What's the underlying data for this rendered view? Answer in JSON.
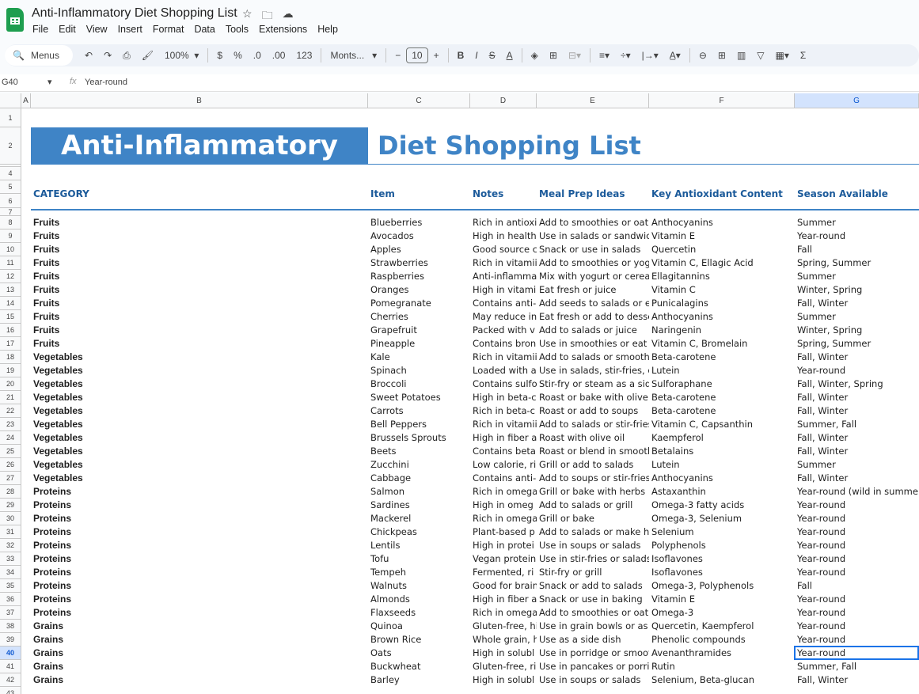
{
  "app": {
    "title": "Anti-Inflammatory Diet Shopping List",
    "menu": [
      "File",
      "Edit",
      "View",
      "Insert",
      "Format",
      "Data",
      "Tools",
      "Extensions",
      "Help"
    ]
  },
  "toolbar": {
    "search": "Menus",
    "zoom": "100%",
    "currency": "$",
    "percent": "%",
    "dec_less": ".0",
    "dec_more": ".00",
    "number_format": "123",
    "font": "Monts...",
    "font_size": "10"
  },
  "formula_bar": {
    "cell_ref": "G40",
    "fx": "fx",
    "value": "Year-round"
  },
  "columns": [
    "A",
    "B",
    "C",
    "D",
    "E",
    "F",
    "G"
  ],
  "selected_column": "G",
  "selected_row": "40",
  "sheet": {
    "banner_left": "Anti-Inflammatory",
    "banner_right": "Diet Shopping List",
    "headers": [
      "CATEGORY",
      "Item",
      "Notes",
      "Meal Prep Ideas",
      "Key Antioxidant Content",
      "Season Available"
    ],
    "rows": [
      [
        "Fruits",
        "Blueberries",
        "Rich in antioxi",
        "Add to smoothies or oatr",
        "Anthocyanins",
        "Summer"
      ],
      [
        "Fruits",
        "Avocados",
        "High in health",
        "Use in salads or sandwicl",
        "Vitamin E",
        "Year-round"
      ],
      [
        "Fruits",
        "Apples",
        "Good source c",
        "Snack or use in salads",
        "Quercetin",
        "Fall"
      ],
      [
        "Fruits",
        "Strawberries",
        "Rich in vitamii",
        "Add to smoothies or yog",
        "Vitamin C, Ellagic Acid",
        "Spring, Summer"
      ],
      [
        "Fruits",
        "Raspberries",
        "Anti-inflamma",
        "Mix with yogurt or cereal",
        "Ellagitannins",
        "Summer"
      ],
      [
        "Fruits",
        "Oranges",
        "High in vitami",
        "Eat fresh or juice",
        "Vitamin C",
        "Winter, Spring"
      ],
      [
        "Fruits",
        "Pomegranate",
        "Contains anti-",
        "Add seeds to salads or ea",
        "Punicalagins",
        "Fall, Winter"
      ],
      [
        "Fruits",
        "Cherries",
        "May reduce in",
        "Eat fresh or add to desse",
        "Anthocyanins",
        "Summer"
      ],
      [
        "Fruits",
        "Grapefruit",
        "Packed with v",
        "Add to salads or juice",
        "Naringenin",
        "Winter, Spring"
      ],
      [
        "Fruits",
        "Pineapple",
        "Contains bron",
        "Use in smoothies or eat f",
        "Vitamin C, Bromelain",
        "Spring, Summer"
      ],
      [
        "Vegetables",
        "Kale",
        "Rich in vitamii",
        "Add to salads or smoothi",
        "Beta-carotene",
        "Fall, Winter"
      ],
      [
        "Vegetables",
        "Spinach",
        "Loaded with a",
        "Use in salads, stir-fries, or",
        "Lutein",
        "Year-round"
      ],
      [
        "Vegetables",
        "Broccoli",
        "Contains sulfo",
        "Stir-fry or steam as a side",
        "Sulforaphane",
        "Fall, Winter, Spring"
      ],
      [
        "Vegetables",
        "Sweet Potatoes",
        "High in beta-c",
        "Roast or bake with olive c",
        "Beta-carotene",
        "Fall, Winter"
      ],
      [
        "Vegetables",
        "Carrots",
        "Rich in beta-c",
        "Roast or add to soups",
        "Beta-carotene",
        "Fall, Winter"
      ],
      [
        "Vegetables",
        "Bell Peppers",
        "Rich in vitamii",
        "Add to salads or stir-fries",
        "Vitamin C, Capsanthin",
        "Summer, Fall"
      ],
      [
        "Vegetables",
        "Brussels Sprouts",
        "High in fiber a",
        "Roast with olive oil",
        "Kaempferol",
        "Fall, Winter"
      ],
      [
        "Vegetables",
        "Beets",
        "Contains beta",
        "Roast or blend in smooth",
        "Betalains",
        "Fall, Winter"
      ],
      [
        "Vegetables",
        "Zucchini",
        "Low calorie, ri",
        "Grill or add to salads",
        "Lutein",
        "Summer"
      ],
      [
        "Vegetables",
        "Cabbage",
        "Contains anti-",
        "Add to soups or stir-fries",
        "Anthocyanins",
        "Fall, Winter"
      ],
      [
        "Proteins",
        "Salmon",
        "Rich in omega",
        "Grill or bake with herbs",
        "Astaxanthin",
        "Year-round (wild in summer)"
      ],
      [
        "Proteins",
        "Sardines",
        "High in omeg",
        "Add to salads or grill",
        "Omega-3 fatty acids",
        "Year-round"
      ],
      [
        "Proteins",
        "Mackerel",
        "Rich in omega",
        "Grill or bake",
        "Omega-3, Selenium",
        "Year-round"
      ],
      [
        "Proteins",
        "Chickpeas",
        "Plant-based p",
        "Add to salads or make hu",
        "Selenium",
        "Year-round"
      ],
      [
        "Proteins",
        "Lentils",
        "High in protei",
        "Use in soups or salads",
        "Polyphenols",
        "Year-round"
      ],
      [
        "Proteins",
        "Tofu",
        "Vegan protein",
        "Use in stir-fries or salads",
        "Isoflavones",
        "Year-round"
      ],
      [
        "Proteins",
        "Tempeh",
        "Fermented, ri",
        "Stir-fry or grill",
        "Isoflavones",
        "Year-round"
      ],
      [
        "Proteins",
        "Walnuts",
        "Good for brain",
        "Snack or add to salads",
        "Omega-3, Polyphenols",
        "Fall"
      ],
      [
        "Proteins",
        "Almonds",
        "High in fiber a",
        "Snack or use in baking",
        "Vitamin E",
        "Year-round"
      ],
      [
        "Proteins",
        "Flaxseeds",
        "Rich in omega",
        "Add to smoothies or oatr",
        "Omega-3",
        "Year-round"
      ],
      [
        "Grains",
        "Quinoa",
        "Gluten-free, hi",
        "Use in grain bowls or as a",
        "Quercetin, Kaempferol",
        "Year-round"
      ],
      [
        "Grains",
        "Brown Rice",
        "Whole grain, h",
        "Use as a side dish",
        "Phenolic compounds",
        "Year-round"
      ],
      [
        "Grains",
        "Oats",
        "High in solubl",
        "Use in porridge or smoot",
        "Avenanthramides",
        "Year-round"
      ],
      [
        "Grains",
        "Buckwheat",
        "Gluten-free, ri",
        "Use in pancakes or porrid",
        "Rutin",
        "Summer, Fall"
      ],
      [
        "Grains",
        "Barley",
        "High in solubl",
        "Use in soups or salads",
        "Selenium, Beta-glucan",
        "Fall, Winter"
      ]
    ]
  }
}
